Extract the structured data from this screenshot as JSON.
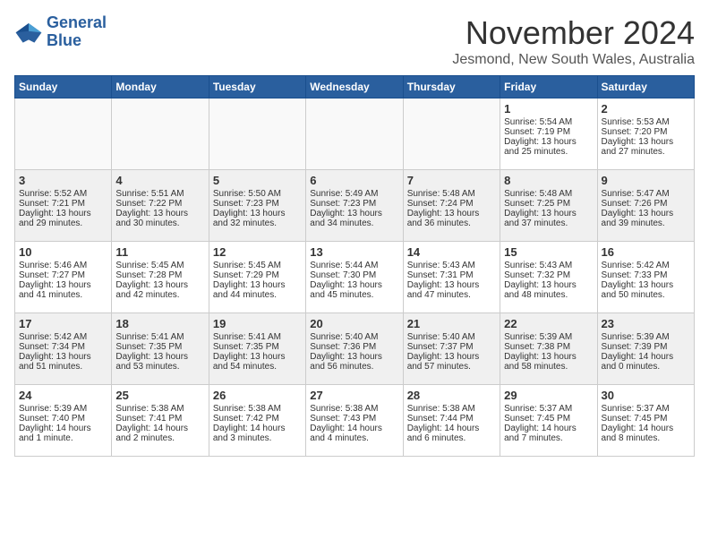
{
  "logo": {
    "line1": "General",
    "line2": "Blue"
  },
  "title": "November 2024",
  "location": "Jesmond, New South Wales, Australia",
  "days_of_week": [
    "Sunday",
    "Monday",
    "Tuesday",
    "Wednesday",
    "Thursday",
    "Friday",
    "Saturday"
  ],
  "weeks": [
    [
      {
        "day": "",
        "info": ""
      },
      {
        "day": "",
        "info": ""
      },
      {
        "day": "",
        "info": ""
      },
      {
        "day": "",
        "info": ""
      },
      {
        "day": "",
        "info": ""
      },
      {
        "day": "1",
        "info": "Sunrise: 5:54 AM\nSunset: 7:19 PM\nDaylight: 13 hours\nand 25 minutes."
      },
      {
        "day": "2",
        "info": "Sunrise: 5:53 AM\nSunset: 7:20 PM\nDaylight: 13 hours\nand 27 minutes."
      }
    ],
    [
      {
        "day": "3",
        "info": "Sunrise: 5:52 AM\nSunset: 7:21 PM\nDaylight: 13 hours\nand 29 minutes."
      },
      {
        "day": "4",
        "info": "Sunrise: 5:51 AM\nSunset: 7:22 PM\nDaylight: 13 hours\nand 30 minutes."
      },
      {
        "day": "5",
        "info": "Sunrise: 5:50 AM\nSunset: 7:23 PM\nDaylight: 13 hours\nand 32 minutes."
      },
      {
        "day": "6",
        "info": "Sunrise: 5:49 AM\nSunset: 7:23 PM\nDaylight: 13 hours\nand 34 minutes."
      },
      {
        "day": "7",
        "info": "Sunrise: 5:48 AM\nSunset: 7:24 PM\nDaylight: 13 hours\nand 36 minutes."
      },
      {
        "day": "8",
        "info": "Sunrise: 5:48 AM\nSunset: 7:25 PM\nDaylight: 13 hours\nand 37 minutes."
      },
      {
        "day": "9",
        "info": "Sunrise: 5:47 AM\nSunset: 7:26 PM\nDaylight: 13 hours\nand 39 minutes."
      }
    ],
    [
      {
        "day": "10",
        "info": "Sunrise: 5:46 AM\nSunset: 7:27 PM\nDaylight: 13 hours\nand 41 minutes."
      },
      {
        "day": "11",
        "info": "Sunrise: 5:45 AM\nSunset: 7:28 PM\nDaylight: 13 hours\nand 42 minutes."
      },
      {
        "day": "12",
        "info": "Sunrise: 5:45 AM\nSunset: 7:29 PM\nDaylight: 13 hours\nand 44 minutes."
      },
      {
        "day": "13",
        "info": "Sunrise: 5:44 AM\nSunset: 7:30 PM\nDaylight: 13 hours\nand 45 minutes."
      },
      {
        "day": "14",
        "info": "Sunrise: 5:43 AM\nSunset: 7:31 PM\nDaylight: 13 hours\nand 47 minutes."
      },
      {
        "day": "15",
        "info": "Sunrise: 5:43 AM\nSunset: 7:32 PM\nDaylight: 13 hours\nand 48 minutes."
      },
      {
        "day": "16",
        "info": "Sunrise: 5:42 AM\nSunset: 7:33 PM\nDaylight: 13 hours\nand 50 minutes."
      }
    ],
    [
      {
        "day": "17",
        "info": "Sunrise: 5:42 AM\nSunset: 7:34 PM\nDaylight: 13 hours\nand 51 minutes."
      },
      {
        "day": "18",
        "info": "Sunrise: 5:41 AM\nSunset: 7:35 PM\nDaylight: 13 hours\nand 53 minutes."
      },
      {
        "day": "19",
        "info": "Sunrise: 5:41 AM\nSunset: 7:35 PM\nDaylight: 13 hours\nand 54 minutes."
      },
      {
        "day": "20",
        "info": "Sunrise: 5:40 AM\nSunset: 7:36 PM\nDaylight: 13 hours\nand 56 minutes."
      },
      {
        "day": "21",
        "info": "Sunrise: 5:40 AM\nSunset: 7:37 PM\nDaylight: 13 hours\nand 57 minutes."
      },
      {
        "day": "22",
        "info": "Sunrise: 5:39 AM\nSunset: 7:38 PM\nDaylight: 13 hours\nand 58 minutes."
      },
      {
        "day": "23",
        "info": "Sunrise: 5:39 AM\nSunset: 7:39 PM\nDaylight: 14 hours\nand 0 minutes."
      }
    ],
    [
      {
        "day": "24",
        "info": "Sunrise: 5:39 AM\nSunset: 7:40 PM\nDaylight: 14 hours\nand 1 minute."
      },
      {
        "day": "25",
        "info": "Sunrise: 5:38 AM\nSunset: 7:41 PM\nDaylight: 14 hours\nand 2 minutes."
      },
      {
        "day": "26",
        "info": "Sunrise: 5:38 AM\nSunset: 7:42 PM\nDaylight: 14 hours\nand 3 minutes."
      },
      {
        "day": "27",
        "info": "Sunrise: 5:38 AM\nSunset: 7:43 PM\nDaylight: 14 hours\nand 4 minutes."
      },
      {
        "day": "28",
        "info": "Sunrise: 5:38 AM\nSunset: 7:44 PM\nDaylight: 14 hours\nand 6 minutes."
      },
      {
        "day": "29",
        "info": "Sunrise: 5:37 AM\nSunset: 7:45 PM\nDaylight: 14 hours\nand 7 minutes."
      },
      {
        "day": "30",
        "info": "Sunrise: 5:37 AM\nSunset: 7:45 PM\nDaylight: 14 hours\nand 8 minutes."
      }
    ]
  ]
}
